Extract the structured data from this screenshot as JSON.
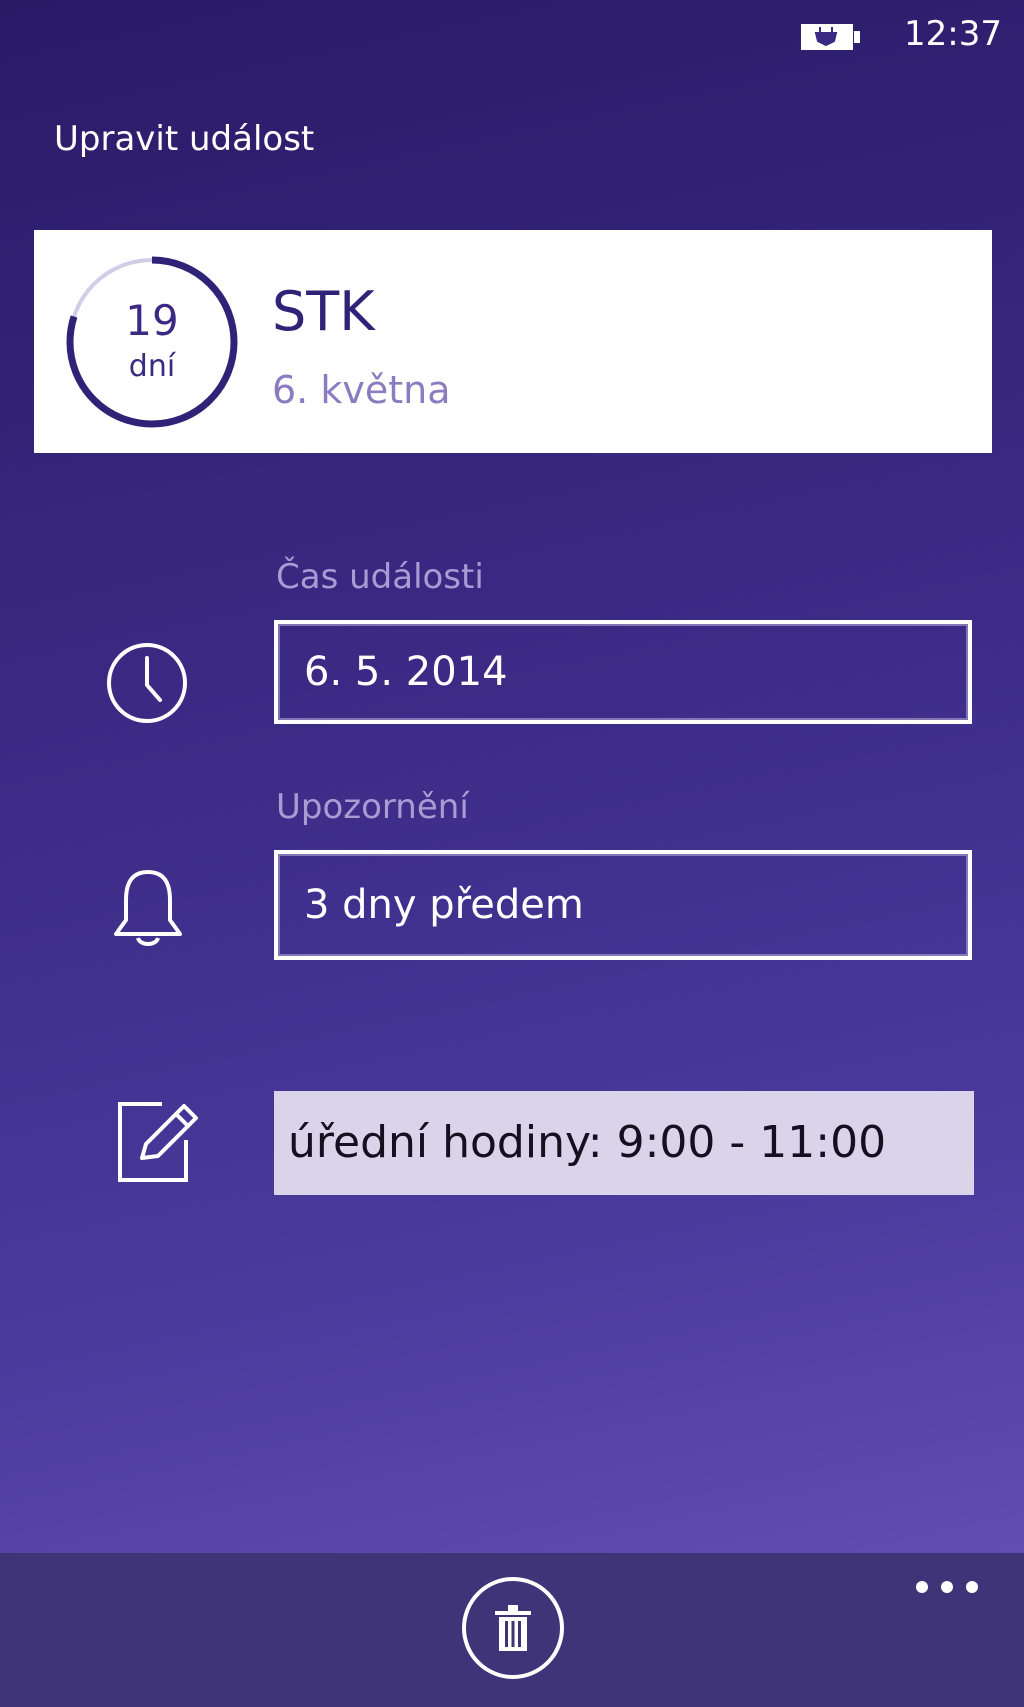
{
  "status_bar": {
    "time": "12:37",
    "battery_icon": "battery-charging-icon"
  },
  "page_title": "Upravit událost",
  "event": {
    "days_remaining": "19",
    "days_unit": "dní",
    "countdown_progress": 0.8,
    "name": "STK",
    "date": "6. května"
  },
  "time_field": {
    "label": "Čas události",
    "value": "6. 5. 2014",
    "icon": "clock-icon"
  },
  "reminder_field": {
    "label": "Upozornění",
    "value": "3 dny předem",
    "icon": "bell-icon"
  },
  "note_field": {
    "value": "úřední hodiny: 9:00 - 11:00",
    "icon": "edit-icon"
  },
  "app_bar": {
    "delete_icon": "trash-icon",
    "more_icon": "ellipsis-icon"
  },
  "colors": {
    "background_top": "#2a1a66",
    "background_bottom": "#6a54bc",
    "accent": "#3a2a84",
    "card": "#ffffff",
    "note_field_bg": "#d9d4ea",
    "app_bar": "#3f3477"
  }
}
